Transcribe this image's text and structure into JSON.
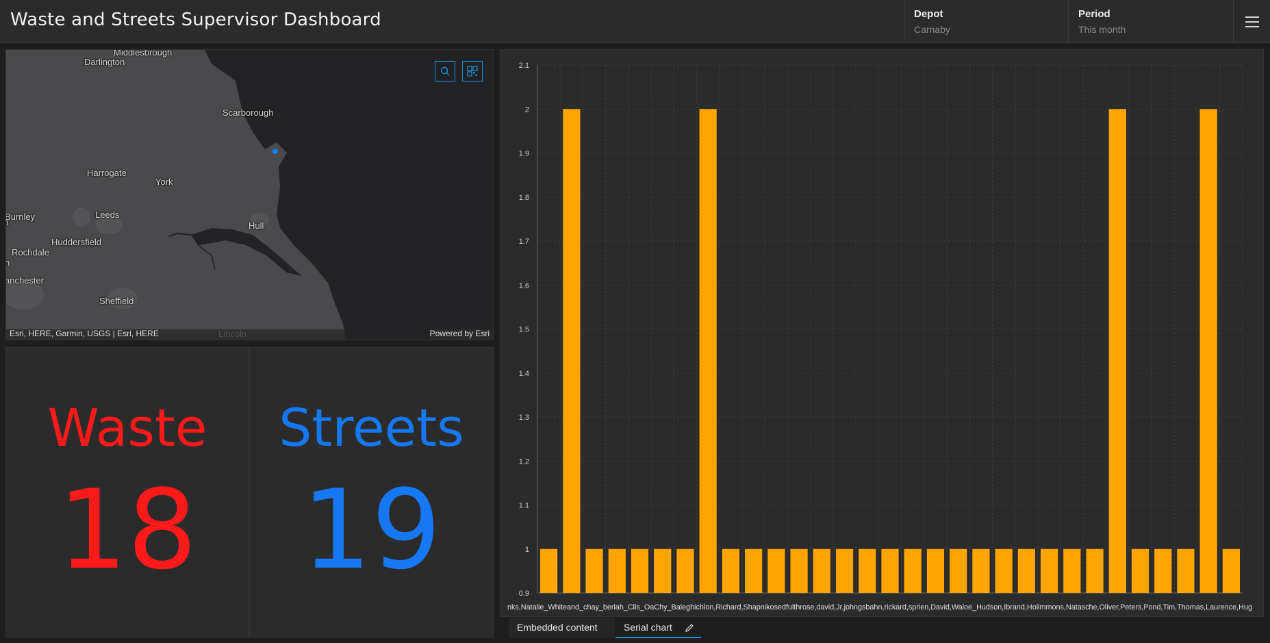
{
  "header": {
    "title": "Waste and Streets Supervisor Dashboard",
    "selectors": [
      {
        "label": "Depot",
        "value": "Carnaby"
      },
      {
        "label": "Period",
        "value": "This month"
      }
    ],
    "menu_icon": "hamburger-menu-icon"
  },
  "map": {
    "places": [
      "Middlesbrough",
      "Darlington",
      "Scarborough",
      "Harrogate",
      "York",
      "Burnley",
      "Leeds",
      "Hull",
      "Huddersfield",
      "Rochdale",
      "anchester",
      "Sheffield",
      "Lincoln",
      "n",
      "n"
    ],
    "attribution": "Esri, HERE, Garmin, USGS | Esri, HERE",
    "powered_by": "Powered by Esri",
    "marker_color": "#1a7cf0",
    "tools": [
      "search-icon",
      "qr-grid-icon"
    ]
  },
  "indicators": [
    {
      "label": "Waste",
      "value": "18",
      "color": "#ff1a1a"
    },
    {
      "label": "Streets",
      "value": "19",
      "color": "#1678f2"
    }
  ],
  "chart_data": {
    "type": "bar",
    "bar_color": "#ffa500",
    "ylim": [
      0.9,
      2.1
    ],
    "yticks": [
      0.9,
      1,
      1.1,
      1.2,
      1.3,
      1.4,
      1.5,
      1.6,
      1.7,
      1.8,
      1.9,
      2,
      2.1
    ],
    "values": [
      1,
      2,
      1,
      1,
      1,
      1,
      1,
      2,
      1,
      1,
      1,
      1,
      1,
      1,
      1,
      1,
      1,
      1,
      1,
      1,
      1,
      1,
      1,
      1,
      1,
      2,
      1,
      1,
      1,
      2,
      1
    ],
    "xlabel_overlap": "nks,Natalie_Whiteand_chay_berlah_Clis_OaChy_Baleghichlon,Richard,Shapnikosedfulthrose,david,Jr,johngsbahn,rickard,sprien,David,Waloe_Hudson,Ibrand,Holimmons,Natasche,Oliver,Peters,Pond,Tim,Thomas,Laurence,Hug",
    "grid": true
  },
  "tabs": [
    {
      "label": "Embedded content"
    },
    {
      "label": "Serial chart",
      "icon": "pencil-icon"
    }
  ]
}
